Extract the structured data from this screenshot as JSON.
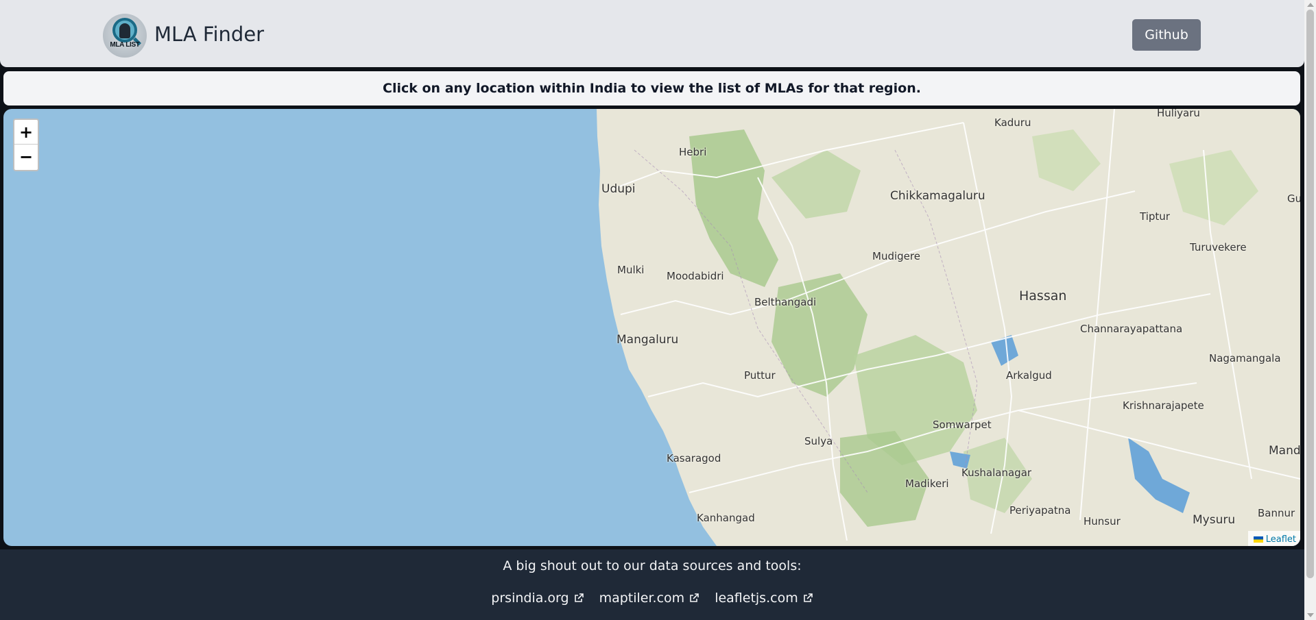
{
  "header": {
    "logo_text": "MLA LIST",
    "title": "MLA Finder",
    "github_label": "Github"
  },
  "notice": "Click on any location within India to view the list of MLAs for that region.",
  "map": {
    "zoom_in": "+",
    "zoom_out": "−",
    "attribution": "Leaflet",
    "places": [
      "Hebri",
      "Kaduru",
      "Huliyaru",
      "Udupi",
      "Chikkamagaluru",
      "Gu",
      "Tiptur",
      "Mudigere",
      "Turuvekere",
      "Mulki",
      "Moodabidri",
      "Hassan",
      "Belthangadi",
      "Channarayapattana",
      "Mangaluru",
      "Nagamangala",
      "Puttur",
      "Arkalgud",
      "Krishnarajapete",
      "Somwarpet",
      "Sulya",
      "Kasaragod",
      "Mandy",
      "Kushalanagar",
      "Madikeri",
      "Periyapatna",
      "Kanhangad",
      "Hunsur",
      "Mysuru",
      "Bannur"
    ],
    "colors": {
      "water": "#93c0e0",
      "land": "#e8e6d8",
      "forest": "#a9c98f"
    }
  },
  "footer": {
    "title": "A big shout out to our data sources and tools:",
    "links": [
      "prsindia.org",
      "maptiler.com",
      "leafletjs.com"
    ]
  }
}
